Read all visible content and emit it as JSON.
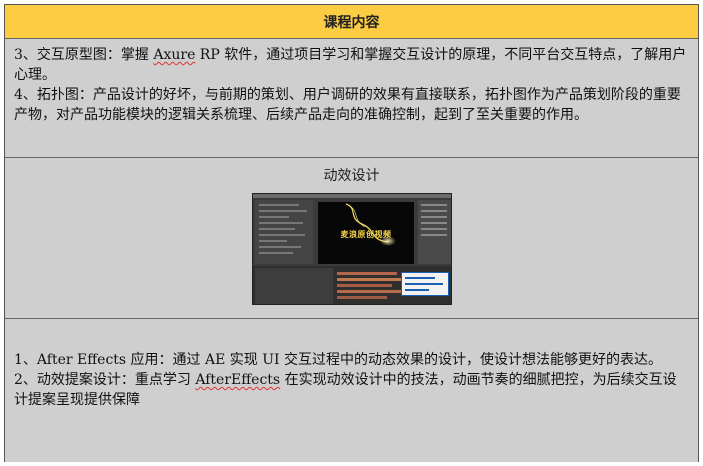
{
  "header": {
    "title": "课程内容"
  },
  "section1": {
    "items": [
      {
        "before": "3、交互原型图：掌握 ",
        "word1": "Axure",
        "mid": " RP 软件，通过项目学习和掌握交互设计的原理，不同平台交互特点，了解用户心理。"
      },
      {
        "text": "4、拓扑图：产品设计的好坏，与前期的策划、用户调研的效果有直接联系，拓扑图作为产品策划阶段的重要产物，对产品功能模块的逻辑关系梳理、后续产品走向的准确控制，起到了至关重要的作用。"
      }
    ]
  },
  "section2": {
    "title": "动效设计",
    "image": {
      "caption_text": "麦浪原创视频"
    }
  },
  "section3": {
    "items": [
      {
        "text": "1、After Effects 应用：通过 AE 实现 UI 交互过程中的动态效果的设计，使设计想法能够更好的表达。"
      },
      {
        "before": "2、动效提案设计：重点学习 ",
        "word": "AfterEffects",
        "after": " 在实现动效设计中的技法，动画节奏的细腻把控，为后续交互设计提案呈现提供保障"
      }
    ]
  }
}
